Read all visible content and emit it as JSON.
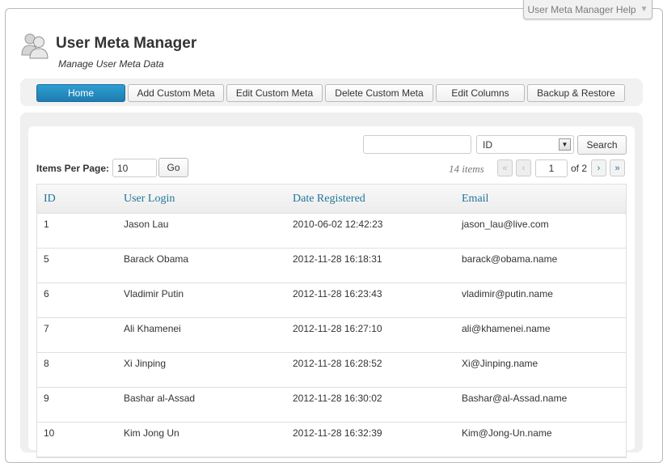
{
  "help_tab": {
    "label": "User Meta Manager Help"
  },
  "header": {
    "title": "User Meta Manager",
    "subtitle": "Manage User Meta Data"
  },
  "nav": {
    "home": "Home",
    "add_custom_meta": "Add Custom Meta",
    "edit_custom_meta": "Edit Custom Meta",
    "delete_custom_meta": "Delete Custom Meta",
    "edit_columns": "Edit Columns",
    "backup_restore": "Backup & Restore"
  },
  "search": {
    "value": "",
    "field_select": "ID",
    "button": "Search"
  },
  "items_per_page": {
    "label": "Items Per Page:",
    "value": "10",
    "button": "Go"
  },
  "pagination": {
    "items": "14 items",
    "first": "«",
    "prev": "‹",
    "current": "1",
    "total": "of 2",
    "next": "›",
    "last": "»"
  },
  "table": {
    "columns": [
      "ID",
      "User Login",
      "Date Registered",
      "Email"
    ],
    "rows": [
      [
        "1",
        "Jason Lau",
        "2010-06-02 12:42:23",
        "jason_lau@live.com"
      ],
      [
        "5",
        "Barack Obama",
        "2012-11-28 16:18:31",
        "barack@obama.name"
      ],
      [
        "6",
        "Vladimir Putin",
        "2012-11-28 16:23:43",
        "vladimir@putin.name"
      ],
      [
        "7",
        "Ali Khamenei",
        "2012-11-28 16:27:10",
        "ali@khamenei.name"
      ],
      [
        "8",
        "Xi Jinping",
        "2012-11-28 16:28:52",
        "Xi@Jinping.name"
      ],
      [
        "9",
        "Bashar al-Assad",
        "2012-11-28 16:30:02",
        "Bashar@al-Assad.name"
      ],
      [
        "10",
        "Kim Jong Un",
        "2012-11-28 16:32:39",
        "Kim@Jong-Un.name"
      ]
    ]
  },
  "colors": {
    "accent": "#21759b",
    "active_button": "#2589c0"
  }
}
